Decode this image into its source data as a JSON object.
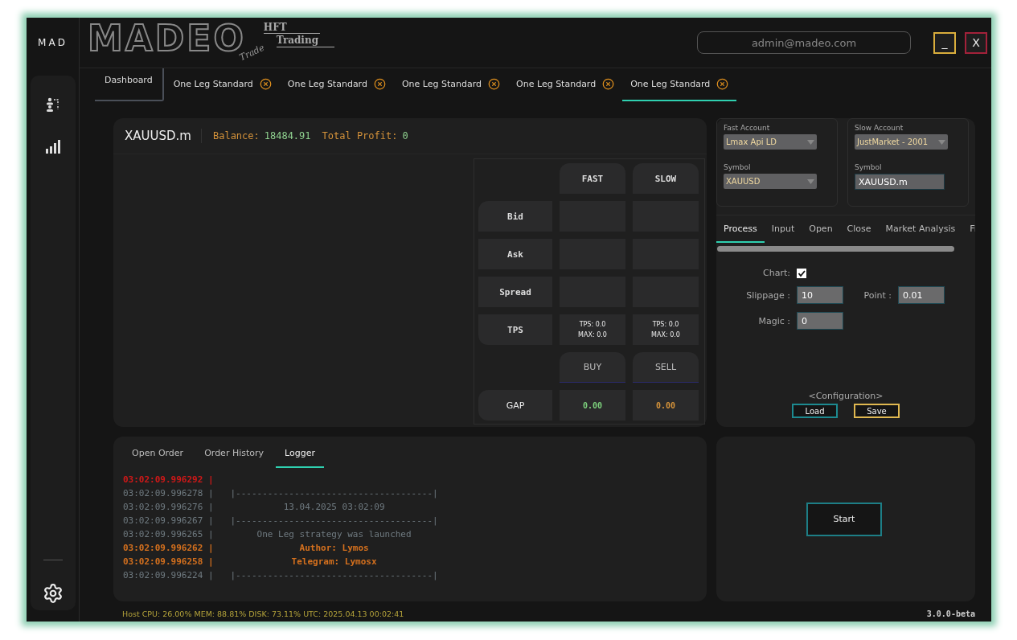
{
  "sidebar": {
    "brand": "MAD",
    "items": [
      {
        "kind": "accounts",
        "selected": false
      },
      {
        "kind": "chart",
        "selected": false
      }
    ]
  },
  "header": {
    "logo": {
      "word": "MADEO",
      "script": "Trade",
      "line_1": "HFT",
      "line_2": "Trading"
    },
    "user_email": "admin@madeo.com",
    "minimize": "_",
    "close": "X"
  },
  "tabs": [
    {
      "label": "Dashboard",
      "kind": "home",
      "selected": false
    },
    {
      "label": "One Leg Standard",
      "kind": "strategy",
      "selected": false
    },
    {
      "label": "One Leg Standard",
      "kind": "strategy",
      "selected": false
    },
    {
      "label": "One Leg Standard",
      "kind": "strategy",
      "selected": false
    },
    {
      "label": "One Leg Standard",
      "kind": "strategy",
      "selected": false
    },
    {
      "label": "One Leg Standard",
      "kind": "strategy",
      "selected": true
    }
  ],
  "quote_panel": {
    "symbol": "XAUUSD.m",
    "balance_label": "Balance:",
    "balance": "18484.91",
    "profit_label": "Total Profit:",
    "profit": "0",
    "columns": [
      "FAST",
      "SLOW"
    ],
    "rows": [
      {
        "kind": "plain",
        "label": "Bid",
        "cells": [
          "",
          ""
        ]
      },
      {
        "kind": "plain",
        "label": "Ask",
        "cells": [
          "",
          ""
        ]
      },
      {
        "kind": "plain",
        "label": "Spread",
        "cells": [
          "",
          ""
        ]
      },
      {
        "kind": "tps",
        "label": "TPS",
        "cells": [
          [
            "TPS: 0.0",
            "MAX: 0.0"
          ],
          [
            "TPS: 0.0",
            "MAX: 0.0"
          ]
        ]
      },
      {
        "kind": "actions",
        "buttons": [
          "BUY",
          "SELL"
        ]
      },
      {
        "kind": "gap",
        "label": "GAP",
        "cells": [
          {
            "text": "0.00",
            "color": "#7ccf7c"
          },
          {
            "text": "0.00",
            "color": "#d4923a"
          }
        ]
      }
    ]
  },
  "settings_panel": {
    "fast_account": {
      "label": "Fast Account",
      "value": "Lmax Api LD",
      "symbol_label": "Symbol",
      "symbol": "XAUUSD"
    },
    "slow_account": {
      "label": "Slow Account",
      "value": "JustMarket - 2001",
      "symbol_label": "Symbol",
      "symbol": "XAUUSD.m"
    },
    "tabs": [
      {
        "label": "Process",
        "selected": true
      },
      {
        "label": "Input",
        "selected": false
      },
      {
        "label": "Open",
        "selected": false
      },
      {
        "label": "Close",
        "selected": false
      },
      {
        "label": "Market Analysis",
        "selected": false
      },
      {
        "label": "Fi",
        "selected": false
      }
    ],
    "chart": {
      "label": "Chart:",
      "checked": true
    },
    "slippage": {
      "label": "Slippage :",
      "value": "10"
    },
    "point": {
      "label": "Point :",
      "value": "0.01"
    },
    "magic": {
      "label": "Magic :",
      "value": "0"
    },
    "configuration": "<Configuration>",
    "load": "Load",
    "save": "Save"
  },
  "log_panel": {
    "tabs": [
      {
        "label": "Open Order",
        "selected": false
      },
      {
        "label": "Order History",
        "selected": false
      },
      {
        "label": "Logger",
        "selected": true
      }
    ],
    "lines": [
      {
        "kind": "error",
        "stamp": "03:02:09.996292 |"
      },
      {
        "kind": "info",
        "stamp": "03:02:09.996278 |",
        "message": "|-------------------------------------|"
      },
      {
        "kind": "info",
        "stamp": "03:02:09.996276 |",
        "message": "13.04.2025 03:02:09"
      },
      {
        "kind": "info",
        "stamp": "03:02:09.996267 |",
        "message": "|-------------------------------------|"
      },
      {
        "kind": "info",
        "stamp": "03:02:09.996265 |",
        "message": "One Leg strategy was launched"
      },
      {
        "kind": "warn",
        "stamp": "03:02:09.996262 |",
        "message": "Author: Lymos"
      },
      {
        "kind": "warn",
        "stamp": "03:02:09.996258 |",
        "message": "Telegram: Lymosx"
      },
      {
        "kind": "info",
        "stamp": "03:02:09.996224 |",
        "message": "|-------------------------------------|"
      }
    ]
  },
  "start_button": "Start",
  "status_bar": {
    "host": "Host CPU: 26.00% MEM: 88.81% DISK: 73.11%  UTC: 2025.04.13 00:02:41",
    "version": "3.0.0-beta"
  }
}
